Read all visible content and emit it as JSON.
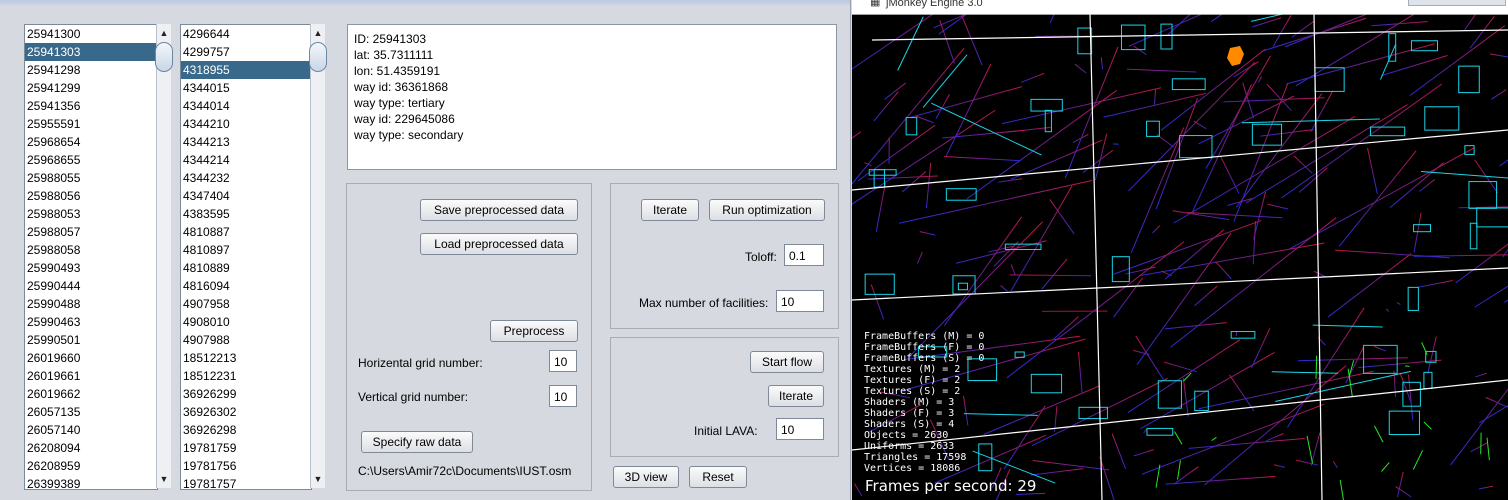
{
  "list1": {
    "items": [
      "25941300",
      "25941303",
      "25941298",
      "25941299",
      "25941356",
      "25955591",
      "25968654",
      "25968655",
      "25988055",
      "25988056",
      "25988053",
      "25988057",
      "25988058",
      "25990493",
      "25990444",
      "25990488",
      "25990463",
      "25990501",
      "26019660",
      "26019661",
      "26019662",
      "26057135",
      "26057140",
      "26208094",
      "26208959",
      "26399389"
    ],
    "selected_index": 1
  },
  "list2": {
    "items": [
      "4296644",
      "4299757",
      "4318955",
      "4344015",
      "4344014",
      "4344210",
      "4344213",
      "4344214",
      "4344232",
      "4347404",
      "4383595",
      "4810887",
      "4810897",
      "4810889",
      "4816094",
      "4907958",
      "4908010",
      "4907988",
      "18512213",
      "18512231",
      "36926299",
      "36926302",
      "36926298",
      "19781759",
      "19781756",
      "19781757"
    ],
    "selected_index": 2
  },
  "info": {
    "lines": [
      "ID: 25941303",
      "lat: 35.7311111",
      "lon: 51.4359191",
      "way id: 36361868",
      "way type: tertiary",
      "way id: 229645086",
      "way type: secondary"
    ]
  },
  "preprocess_panel": {
    "save_label": "Save preprocessed data",
    "load_label": "Load preprocessed data",
    "preprocess_label": "Preprocess",
    "hgrid_label": "Horizental grid number:",
    "hgrid_value": "10",
    "vgrid_label": "Vertical grid number:",
    "vgrid_value": "10",
    "specify_label": "Specify raw data",
    "path": "C:\\Users\\Amir72c\\Documents\\IUST.osm"
  },
  "optimization_panel": {
    "iterate_label": "Iterate",
    "run_label": "Run optimization",
    "toloff_label": "Toloff:",
    "toloff_value": "0.1",
    "maxfac_label": "Max number of facilities:",
    "maxfac_value": "10"
  },
  "flow_panel": {
    "start_label": "Start flow",
    "iterate_label": "Iterate",
    "lava_label": "Initial LAVA:",
    "lava_value": "10"
  },
  "bottom_buttons": {
    "view3d_label": "3D view",
    "reset_label": "Reset"
  },
  "jme": {
    "title": "jMonkey Engine 3.0",
    "stats": [
      "FrameBuffers (M) = 0",
      "FrameBuffers (F) = 0",
      "FrameBuffers (S) = 0",
      "Textures (M) = 2",
      "Textures (F) = 2",
      "Textures (S) = 2",
      "Shaders (M) = 3",
      "Shaders (F) = 3",
      "Shaders (S) = 4",
      "Objects = 2630",
      "Uniforms = 2633",
      "Triangles = 17598",
      "Vertices = 18086"
    ],
    "fps": "Frames per second: 29",
    "colors": {
      "upper": "#c0164a",
      "lower": "#2b2bd8",
      "cyan": "#18d6e8",
      "green": "#26e826",
      "marker": "#ff8a00"
    }
  }
}
